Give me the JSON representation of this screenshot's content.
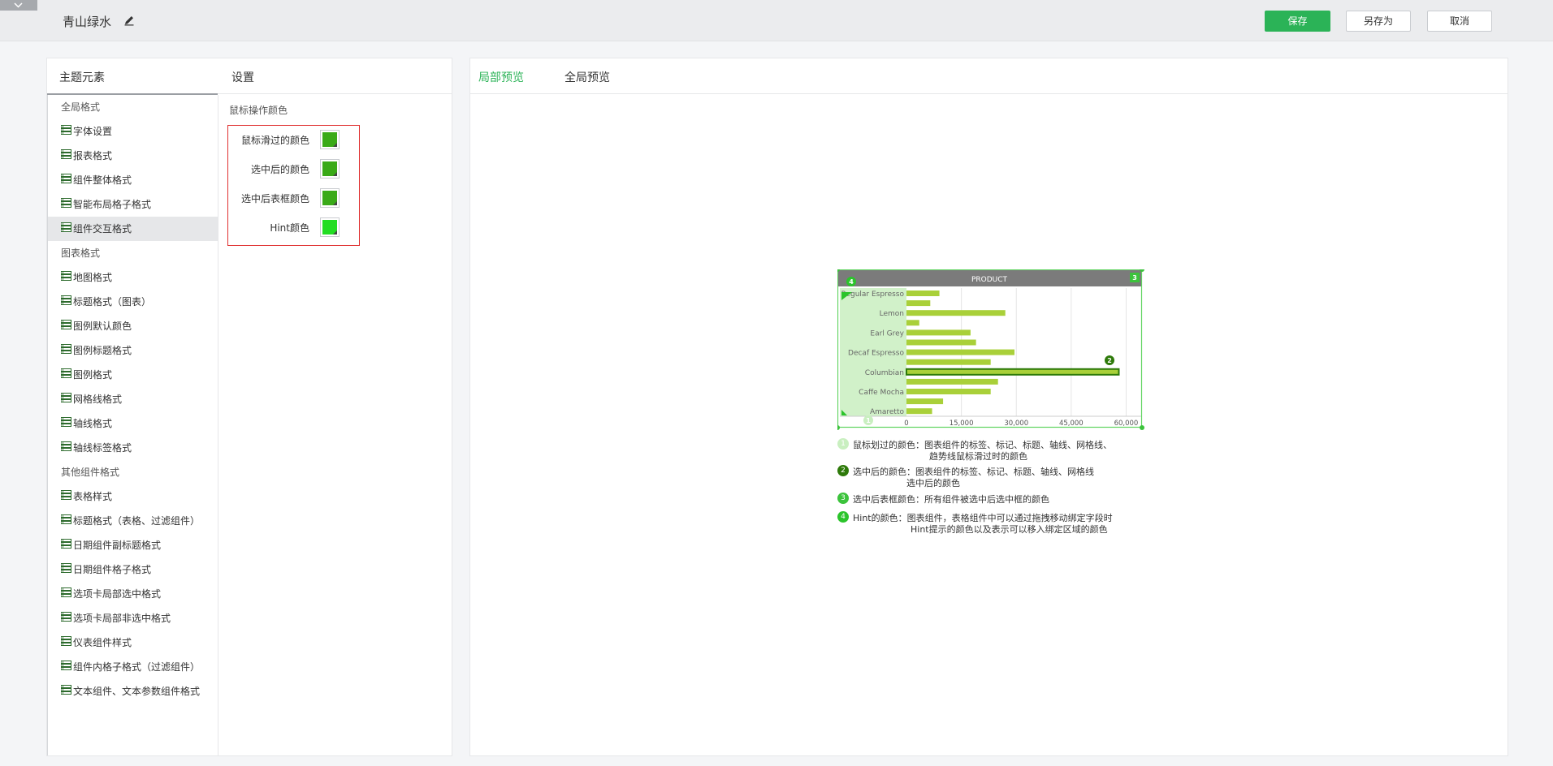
{
  "header": {
    "theme_name": "青山绿水",
    "save_label": "保存",
    "save_as_label": "另存为",
    "cancel_label": "取消"
  },
  "left_panel": {
    "elements_header": "主题元素",
    "settings_header": "设置",
    "theme_items": [
      {
        "label": "全局格式",
        "category": true
      },
      {
        "label": "字体设置"
      },
      {
        "label": "报表格式"
      },
      {
        "label": "组件整体格式"
      },
      {
        "label": "智能布局格子格式"
      },
      {
        "label": "组件交互格式",
        "selected": true
      },
      {
        "label": "图表格式",
        "category": true
      },
      {
        "label": "地图格式"
      },
      {
        "label": "标题格式（图表）"
      },
      {
        "label": "图例默认颜色"
      },
      {
        "label": "图例标题格式"
      },
      {
        "label": "图例格式"
      },
      {
        "label": "网格线格式"
      },
      {
        "label": "轴线格式"
      },
      {
        "label": "轴线标签格式"
      },
      {
        "label": "其他组件格式",
        "category": true
      },
      {
        "label": "表格样式"
      },
      {
        "label": "标题格式（表格、过滤组件）"
      },
      {
        "label": "日期组件副标题格式"
      },
      {
        "label": "日期组件格子格式"
      },
      {
        "label": "选项卡局部选中格式"
      },
      {
        "label": "选项卡局部非选中格式"
      },
      {
        "label": "仪表组件样式"
      },
      {
        "label": "组件内格子格式（过滤组件）"
      },
      {
        "label": "文本组件、文本参数组件格式"
      }
    ],
    "settings": {
      "section_title": "鼠标操作颜色",
      "rows": [
        {
          "label": "鼠标滑过的颜色",
          "color": "#3aaa18"
        },
        {
          "label": "选中后的颜色",
          "color": "#3aaa18"
        },
        {
          "label": "选中后表框颜色",
          "color": "#3aaa18"
        },
        {
          "label": "Hint颜色",
          "color": "#22dd22"
        }
      ]
    }
  },
  "right_panel": {
    "tab_local": "局部预览",
    "tab_global": "全局预览",
    "accent": "#2bb357"
  },
  "chart_data": {
    "type": "bar",
    "title": "PRODUCT",
    "orientation": "horizontal",
    "categories": [
      "Regular Espresso",
      "",
      "Lemon",
      "",
      "Earl Grey",
      "",
      "Decaf Espresso",
      "",
      "Columbian",
      "",
      "Caffe Mocha",
      "",
      "Amaretto"
    ],
    "values": [
      9000,
      6500,
      27000,
      3500,
      17500,
      19000,
      29500,
      23000,
      58000,
      25000,
      23000,
      10000,
      7000
    ],
    "highlighted_index": 8,
    "xlim": [
      0,
      63000
    ],
    "xticks": [
      0,
      15000,
      30000,
      45000,
      60000
    ],
    "xtick_labels": [
      "0",
      "15,000",
      "30,000",
      "45,000",
      "60,000"
    ],
    "bar_color": "#a9d039",
    "highlight_color": "#2e7a0a",
    "hover_color": "#c9efc0",
    "markers": [
      "1",
      "2",
      "3",
      "4"
    ]
  },
  "legend": [
    {
      "num": "1",
      "color": "#c9efc0",
      "line1": "鼠标划过的颜色：图表组件的标签、标记、标题、轴线、网格线、",
      "line2": "趋势线鼠标滑过时的颜色"
    },
    {
      "num": "2",
      "color": "#2e7a0a",
      "line1": "选中后的颜色：图表组件的标签、标记、标题、轴线、网格线",
      "line2": "选中后的颜色"
    },
    {
      "num": "3",
      "color": "#3cc33c",
      "line1": "选中后表框颜色：所有组件被选中后选中框的颜色",
      "line2": ""
    },
    {
      "num": "4",
      "color": "#2bc42b",
      "line1": "Hint的颜色：图表组件，表格组件中可以通过拖拽移动绑定字段时",
      "line2": "Hint提示的颜色以及表示可以移入绑定区域的颜色"
    }
  ]
}
